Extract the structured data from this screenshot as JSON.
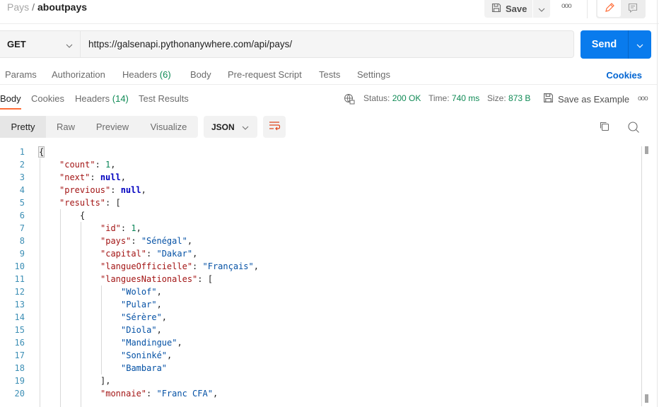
{
  "breadcrumb": {
    "parent": "Pays",
    "separator": "/",
    "current": "aboutpays"
  },
  "toolbar": {
    "save_label": "Save",
    "save_icon": "floppy-disk-icon",
    "more_icon": "ooo"
  },
  "mode_toggle": {
    "edit_icon": "pencil-icon",
    "comment_icon": "comment-icon",
    "active": "edit"
  },
  "request": {
    "method": "GET",
    "url": "https://galsenapi.pythonanywhere.com/api/pays/",
    "send_label": "Send"
  },
  "request_tabs": [
    {
      "label": "Params"
    },
    {
      "label": "Authorization"
    },
    {
      "label": "Headers",
      "count": "(6)"
    },
    {
      "label": "Body"
    },
    {
      "label": "Pre-request Script"
    },
    {
      "label": "Tests"
    },
    {
      "label": "Settings"
    }
  ],
  "cookies_label": "Cookies",
  "response_tabs": [
    {
      "label": "Body",
      "active": true
    },
    {
      "label": "Cookies"
    },
    {
      "label": "Headers",
      "count": "(14)"
    },
    {
      "label": "Test Results"
    }
  ],
  "response_meta": {
    "status_label": "Status:",
    "status_value": "200 OK",
    "time_label": "Time:",
    "time_value": "740 ms",
    "size_label": "Size:",
    "size_value": "873 B",
    "save_example_label": "Save as Example",
    "more_icon": "ooo"
  },
  "view_modes": [
    {
      "label": "Pretty",
      "active": true
    },
    {
      "label": "Raw"
    },
    {
      "label": "Preview"
    },
    {
      "label": "Visualize"
    }
  ],
  "format": "JSON",
  "code_lines": [
    {
      "n": "1",
      "indent": 0,
      "tokens": [
        [
          "p",
          "{"
        ]
      ]
    },
    {
      "n": "2",
      "indent": 1,
      "tokens": [
        [
          "k",
          "\"count\""
        ],
        [
          "p",
          ": "
        ],
        [
          "n",
          "1"
        ],
        [
          "p",
          ","
        ]
      ]
    },
    {
      "n": "3",
      "indent": 1,
      "tokens": [
        [
          "k",
          "\"next\""
        ],
        [
          "p",
          ": "
        ],
        [
          "kw",
          "null"
        ],
        [
          "p",
          ","
        ]
      ]
    },
    {
      "n": "4",
      "indent": 1,
      "tokens": [
        [
          "k",
          "\"previous\""
        ],
        [
          "p",
          ": "
        ],
        [
          "kw",
          "null"
        ],
        [
          "p",
          ","
        ]
      ]
    },
    {
      "n": "5",
      "indent": 1,
      "tokens": [
        [
          "k",
          "\"results\""
        ],
        [
          "p",
          ": ["
        ]
      ]
    },
    {
      "n": "6",
      "indent": 2,
      "tokens": [
        [
          "p",
          "{"
        ]
      ]
    },
    {
      "n": "7",
      "indent": 3,
      "tokens": [
        [
          "k",
          "\"id\""
        ],
        [
          "p",
          ": "
        ],
        [
          "n",
          "1"
        ],
        [
          "p",
          ","
        ]
      ]
    },
    {
      "n": "8",
      "indent": 3,
      "tokens": [
        [
          "k",
          "\"pays\""
        ],
        [
          "p",
          ": "
        ],
        [
          "s",
          "\"Sénégal\""
        ],
        [
          "p",
          ","
        ]
      ]
    },
    {
      "n": "9",
      "indent": 3,
      "tokens": [
        [
          "k",
          "\"capital\""
        ],
        [
          "p",
          ": "
        ],
        [
          "s",
          "\"Dakar\""
        ],
        [
          "p",
          ","
        ]
      ]
    },
    {
      "n": "10",
      "indent": 3,
      "tokens": [
        [
          "k",
          "\"langueOfficielle\""
        ],
        [
          "p",
          ": "
        ],
        [
          "s",
          "\"Français\""
        ],
        [
          "p",
          ","
        ]
      ]
    },
    {
      "n": "11",
      "indent": 3,
      "tokens": [
        [
          "k",
          "\"languesNationales\""
        ],
        [
          "p",
          ": ["
        ]
      ]
    },
    {
      "n": "12",
      "indent": 4,
      "tokens": [
        [
          "s",
          "\"Wolof\""
        ],
        [
          "p",
          ","
        ]
      ]
    },
    {
      "n": "13",
      "indent": 4,
      "tokens": [
        [
          "s",
          "\"Pular\""
        ],
        [
          "p",
          ","
        ]
      ]
    },
    {
      "n": "14",
      "indent": 4,
      "tokens": [
        [
          "s",
          "\"Sérère\""
        ],
        [
          "p",
          ","
        ]
      ]
    },
    {
      "n": "15",
      "indent": 4,
      "tokens": [
        [
          "s",
          "\"Diola\""
        ],
        [
          "p",
          ","
        ]
      ]
    },
    {
      "n": "16",
      "indent": 4,
      "tokens": [
        [
          "s",
          "\"Mandingue\""
        ],
        [
          "p",
          ","
        ]
      ]
    },
    {
      "n": "17",
      "indent": 4,
      "tokens": [
        [
          "s",
          "\"Soninké\""
        ],
        [
          "p",
          ","
        ]
      ]
    },
    {
      "n": "18",
      "indent": 4,
      "tokens": [
        [
          "s",
          "\"Bambara\""
        ]
      ]
    },
    {
      "n": "19",
      "indent": 3,
      "tokens": [
        [
          "p",
          "],"
        ]
      ]
    },
    {
      "n": "20",
      "indent": 3,
      "tokens": [
        [
          "k",
          "\"monnaie\""
        ],
        [
          "p",
          ": "
        ],
        [
          "s",
          "\"Franc CFA\""
        ],
        [
          "p",
          ","
        ]
      ]
    }
  ],
  "colors": {
    "accent": "#ff6c37",
    "send": "#097bed",
    "success": "#0f8a55",
    "link": "#0265d2"
  }
}
